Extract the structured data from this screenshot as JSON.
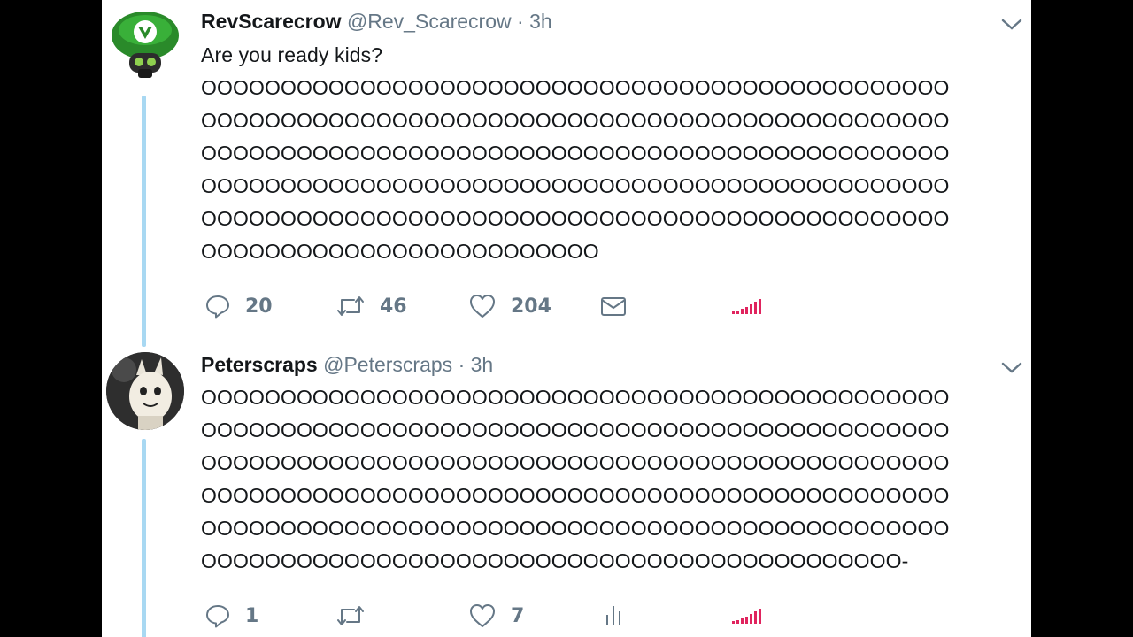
{
  "tweets": [
    {
      "name": "RevScarecrow",
      "handle": "@Rev_Scarecrow",
      "separator": "·",
      "time": "3h",
      "lines": [
        "Are you ready kids?",
        "OOOOOOOOOOOOOOOOOOOOOOOOOOOOOOOOOOOOOOOOOOOOOOO",
        "OOOOOOOOOOOOOOOOOOOOOOOOOOOOOOOOOOOOOOOOOOOOOOO",
        "OOOOOOOOOOOOOOOOOOOOOOOOOOOOOOOOOOOOOOOOOOOOOOO",
        "OOOOOOOOOOOOOOOOOOOOOOOOOOOOOOOOOOOOOOOOOOOOOOO",
        "OOOOOOOOOOOOOOOOOOOOOOOOOOOOOOOOOOOOOOOOOOOOOOO",
        "OOOOOOOOOOOOOOOOOOOOOOOOO"
      ],
      "reply_count": "20",
      "retweet_count": "46",
      "like_count": "204"
    },
    {
      "name": "Peterscraps",
      "handle": "@Peterscraps",
      "separator": "·",
      "time": "3h",
      "lines": [
        "OOOOOOOOOOOOOOOOOOOOOOOOOOOOOOOOOOOOOOOOOOOOOOO",
        "OOOOOOOOOOOOOOOOOOOOOOOOOOOOOOOOOOOOOOOOOOOOOOO",
        "OOOOOOOOOOOOOOOOOOOOOOOOOOOOOOOOOOOOOOOOOOOOOOO",
        "OOOOOOOOOOOOOOOOOOOOOOOOOOOOOOOOOOOOOOOOOOOOOOO",
        "OOOOOOOOOOOOOOOOOOOOOOOOOOOOOOOOOOOOOOOOOOOOOOO",
        "OOOOOOOOOOOOOOOOOOOOOOOOOOOOOOOOOOOOOOOOOOOO-"
      ],
      "reply_count": "1",
      "retweet_count": "",
      "like_count": "7"
    }
  ],
  "icons": {
    "reply": "reply-icon",
    "retweet": "retweet-icon",
    "like": "heart-icon",
    "message": "envelope-icon",
    "analytics": "analytics-icon",
    "signal": "signal-bars-icon",
    "chevron": "chevron-down-icon"
  },
  "colors": {
    "thread_line": "#a8d8f2",
    "muted": "#657786",
    "text": "#14171a",
    "signal": "#e0245e"
  }
}
